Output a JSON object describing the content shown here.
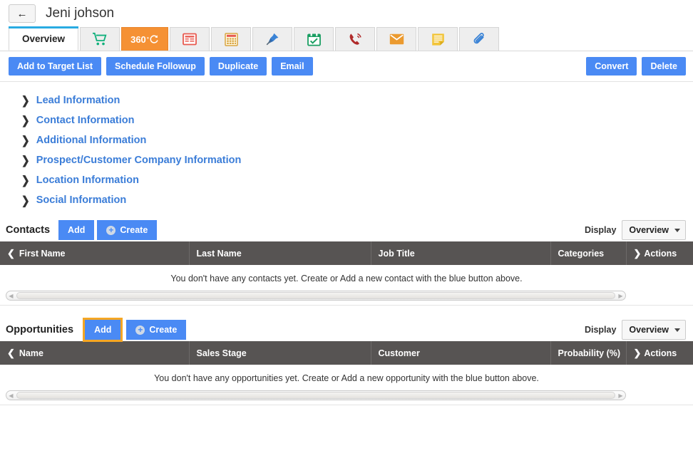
{
  "header": {
    "back_icon": "back-arrow-icon",
    "title": "Jeni johson"
  },
  "tabs": [
    {
      "label": "Overview",
      "icon": "",
      "active": true,
      "style": "text"
    },
    {
      "label": "",
      "icon": "shopping-cart-icon",
      "active": false,
      "style": "icon"
    },
    {
      "label": "360",
      "icon": "refresh-360-icon",
      "active": false,
      "style": "orange"
    },
    {
      "label": "",
      "icon": "document-list-icon",
      "active": false,
      "style": "icon"
    },
    {
      "label": "",
      "icon": "calculator-icon",
      "active": false,
      "style": "icon"
    },
    {
      "label": "",
      "icon": "pin-icon",
      "active": false,
      "style": "icon"
    },
    {
      "label": "",
      "icon": "calendar-check-icon",
      "active": false,
      "style": "icon"
    },
    {
      "label": "",
      "icon": "phone-call-icon",
      "active": false,
      "style": "icon"
    },
    {
      "label": "",
      "icon": "envelope-icon",
      "active": false,
      "style": "icon"
    },
    {
      "label": "",
      "icon": "note-icon",
      "active": false,
      "style": "icon"
    },
    {
      "label": "",
      "icon": "paperclip-icon",
      "active": false,
      "style": "icon"
    }
  ],
  "actionbar": {
    "left": [
      {
        "label": "Add to Target List"
      },
      {
        "label": "Schedule Followup"
      },
      {
        "label": "Duplicate"
      },
      {
        "label": "Email"
      }
    ],
    "right": [
      {
        "label": "Convert"
      },
      {
        "label": "Delete"
      }
    ]
  },
  "sections": [
    {
      "label": "Lead Information"
    },
    {
      "label": "Contact Information"
    },
    {
      "label": "Additional Information"
    },
    {
      "label": "Prospect/Customer Company Information"
    },
    {
      "label": "Location Information"
    },
    {
      "label": "Social Information"
    }
  ],
  "contacts_panel": {
    "title": "Contacts",
    "add_label": "Add",
    "create_label": "Create",
    "display_label": "Display",
    "display_value": "Overview",
    "columns": [
      "First Name",
      "Last Name",
      "Job Title",
      "Categories",
      "Actions"
    ],
    "empty_message": "You don't have any contacts yet. Create or Add a new contact with the blue button above.",
    "rows": []
  },
  "opportunities_panel": {
    "title": "Opportunities",
    "add_label": "Add",
    "create_label": "Create",
    "display_label": "Display",
    "display_value": "Overview",
    "columns": [
      "Name",
      "Sales Stage",
      "Customer",
      "Probability (%)",
      "Actions"
    ],
    "empty_message": "You don't have any opportunities yet. Create or Add a new opportunity with the blue button above.",
    "rows": []
  },
  "colors": {
    "primary_blue": "#4a8af4",
    "link_blue": "#3b7dd8",
    "tab_active_underline": "#29abe2",
    "orange_tab": "#f59134",
    "focus_orange": "#f5a623",
    "table_header": "#575453"
  }
}
